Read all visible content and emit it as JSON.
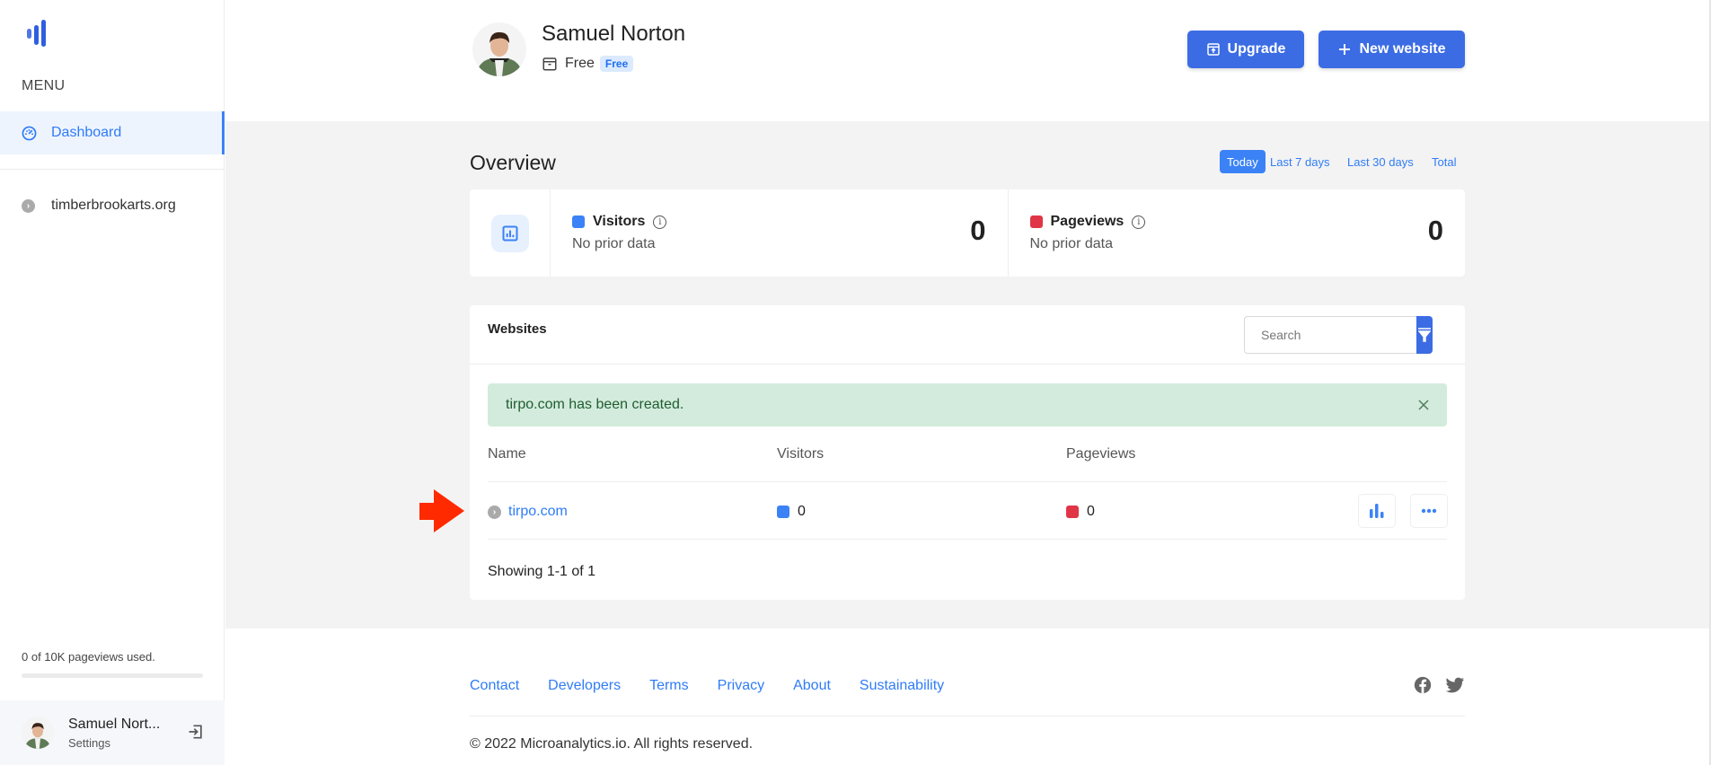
{
  "sidebar": {
    "menu_label": "MENU",
    "items": [
      {
        "label": "Dashboard",
        "icon": "gauge-icon",
        "active": true
      },
      {
        "label": "timberbrookarts.org",
        "icon": "chevron-circle-icon",
        "active": false
      }
    ],
    "usage": {
      "text": "0 of 10K pageviews used.",
      "fraction_used": 0
    },
    "user": {
      "name": "Samuel Nort...",
      "settings_label": "Settings"
    }
  },
  "header": {
    "user_name": "Samuel Norton",
    "plan_label": "Free",
    "plan_badge": "Free",
    "upgrade_label": "Upgrade",
    "new_website_label": "New website"
  },
  "overview": {
    "title": "Overview",
    "ranges": [
      {
        "label": "Today",
        "active": true
      },
      {
        "label": "Last 7 days",
        "active": false
      },
      {
        "label": "Last 30 days",
        "active": false
      },
      {
        "label": "Total",
        "active": false
      }
    ],
    "stats": [
      {
        "label": "Visitors",
        "sub": "No prior data",
        "value": "0",
        "color": "#3b82f6"
      },
      {
        "label": "Pageviews",
        "sub": "No prior data",
        "value": "0",
        "color": "#e03546"
      }
    ]
  },
  "websites": {
    "title": "Websites",
    "search_placeholder": "Search",
    "alert": "tirpo.com has been created.",
    "columns": [
      "Name",
      "Visitors",
      "Pageviews"
    ],
    "rows": [
      {
        "name": "tirpo.com",
        "visitors": "0",
        "pageviews": "0"
      }
    ],
    "showing": "Showing 1-1 of 1"
  },
  "footer": {
    "links": [
      "Contact",
      "Developers",
      "Terms",
      "Privacy",
      "About",
      "Sustainability"
    ],
    "copyright": "© 2022 Microanalytics.io. All rights reserved."
  },
  "colors": {
    "accent": "#3b6ce4",
    "link": "#2f7cf6",
    "visitors": "#3b82f6",
    "pageviews": "#e03546",
    "alert_bg": "#d3ebdc",
    "annotation_arrow": "#ff2a00"
  }
}
